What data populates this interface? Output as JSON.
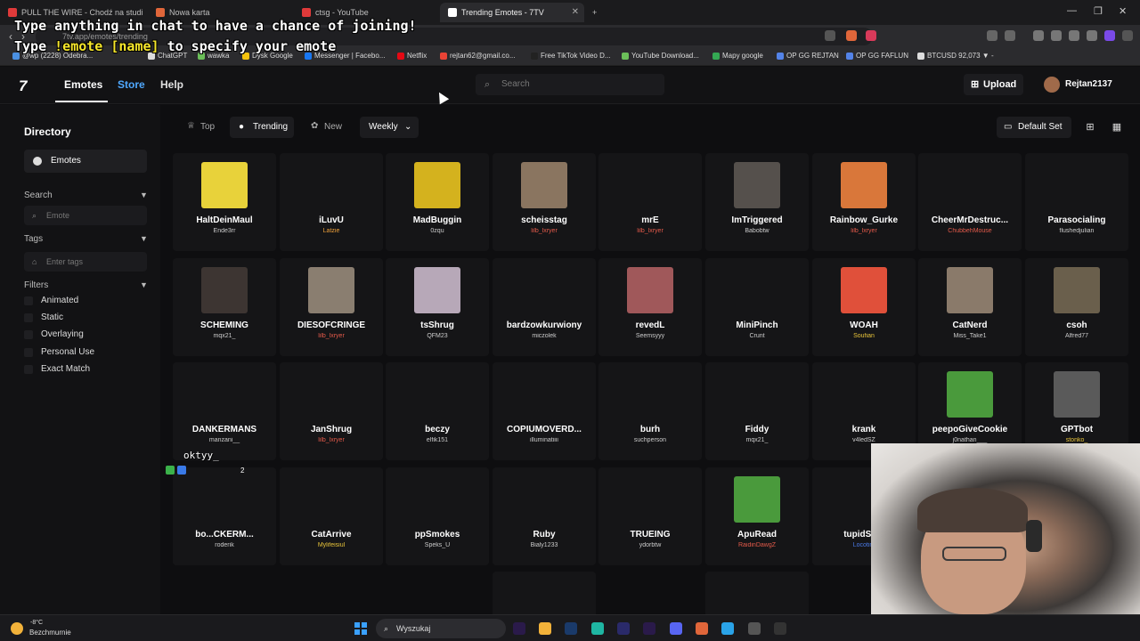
{
  "browser": {
    "tabs": [
      {
        "title": "PULL THE WIRE - Chodź na studia (Z",
        "favicon_color": "#e03a3a"
      },
      {
        "title": "Nowa karta",
        "favicon_color": "#e0663a"
      },
      {
        "title": "ctsg - YouTube",
        "favicon_color": "#e03a3a"
      },
      {
        "title": "Trending Emotes - 7TV",
        "favicon_color": "#ffffff"
      }
    ],
    "url": "7tv.app/emotes/trending",
    "bookmarks": [
      {
        "label": "@wp (2228) Odebra...",
        "color": "#4a90e2"
      },
      {
        "label": "ChatGPT",
        "color": "#dddddd"
      },
      {
        "label": "wawka",
        "color": "#6bbf59"
      },
      {
        "label": "Dysk Google",
        "color": "#f4c20d"
      },
      {
        "label": "Messenger | Facebo...",
        "color": "#1877f2"
      },
      {
        "label": "Netflix",
        "color": "#e50914"
      },
      {
        "label": "rejtan62@gmail.co...",
        "color": "#ea4335"
      },
      {
        "label": "Free TikTok Video D...",
        "color": "#222222"
      },
      {
        "label": "YouTube Download...",
        "color": "#6bbf59"
      },
      {
        "label": "Mapy google",
        "color": "#34a853"
      },
      {
        "label": "OP GG REJTAN",
        "color": "#5383e8"
      },
      {
        "label": "OP GG FAFLUN",
        "color": "#5383e8"
      },
      {
        "label": "BTCUSD 92,073 ▼ -",
        "color": "#dddddd"
      }
    ]
  },
  "overlay": {
    "line1": "Type anything in chat to have a chance of joining!",
    "line2_pre": "Type ",
    "line2_cmd": "!emote [name]",
    "line2_post": " to specify your emote"
  },
  "site": {
    "logo": "7",
    "nav": {
      "emotes": "Emotes",
      "store": "Store",
      "help": "Help"
    },
    "search_placeholder": "Search",
    "upload": "Upload",
    "username": "Rejtan2137"
  },
  "sidebar": {
    "directory": "Directory",
    "emotes": "Emotes",
    "search_label": "Search",
    "search_placeholder": "Emote",
    "tags_label": "Tags",
    "tags_placeholder": "Enter tags",
    "filters_label": "Filters",
    "filters": [
      "Animated",
      "Static",
      "Overlaying",
      "Personal Use",
      "Exact Match"
    ]
  },
  "toolbar": {
    "top": "Top",
    "trending": "Trending",
    "new": "New",
    "period": "Weekly",
    "default_set": "Default Set"
  },
  "emotes": [
    {
      "name": "HaltDeinMaul",
      "owner": "Ende3rr",
      "owner_color": "#cccccc",
      "thumb": "#e8d23a"
    },
    {
      "name": "iLuvU",
      "owner": "Latzie",
      "owner_color": "#f0a13a",
      "thumb": ""
    },
    {
      "name": "MadBuggin",
      "owner": "0zqu",
      "owner_color": "#cccccc",
      "thumb": "#d4b21e"
    },
    {
      "name": "scheisstag",
      "owner": "lilb_lxryer",
      "owner_color": "#e35a4a",
      "thumb": "#8a7560"
    },
    {
      "name": "mrE",
      "owner": "lilb_lxryer",
      "owner_color": "#e35a4a",
      "thumb": ""
    },
    {
      "name": "ImTriggered",
      "owner": "Babobtw",
      "owner_color": "#cccccc",
      "thumb": "#55504c"
    },
    {
      "name": "Rainbow_Gurke",
      "owner": "lilb_lxryer",
      "owner_color": "#e35a4a",
      "thumb": "#d9773a"
    },
    {
      "name": "CheerMrDestruc...",
      "owner": "ChubbehMouse",
      "owner_color": "#e35a4a",
      "thumb": ""
    },
    {
      "name": "Parasocialing",
      "owner": "flushedjulian",
      "owner_color": "#cccccc",
      "thumb": ""
    },
    {
      "name": "SCHEMING",
      "owner": "mqx21_",
      "owner_color": "#cccccc",
      "thumb": "#3d3532"
    },
    {
      "name": "DIESOFCRINGE",
      "owner": "lilb_lxryer",
      "owner_color": "#e35a4a",
      "thumb": "#8a7e70"
    },
    {
      "name": "tsShrug",
      "owner": "QFM23",
      "owner_color": "#cccccc",
      "thumb": "#b7a8b8"
    },
    {
      "name": "bardzowkurwiony",
      "owner": "miczolek",
      "owner_color": "#cccccc",
      "thumb": ""
    },
    {
      "name": "revedL",
      "owner": "Seemsyyy",
      "owner_color": "#cccccc",
      "thumb": "#a0585a"
    },
    {
      "name": "MiniPinch",
      "owner": "Crunt",
      "owner_color": "#cccccc",
      "thumb": ""
    },
    {
      "name": "WOAH",
      "owner": "Soufian",
      "owner_color": "#e8c43a",
      "thumb": "#e0503a"
    },
    {
      "name": "CatNerd",
      "owner": "Miss_Take1",
      "owner_color": "#cccccc",
      "thumb": "#8a7a6a"
    },
    {
      "name": "csoh",
      "owner": "Alfred77",
      "owner_color": "#cccccc",
      "thumb": "#6a5f4c"
    },
    {
      "name": "DANKERMANS",
      "owner": "manzani__",
      "owner_color": "#cccccc",
      "thumb": ""
    },
    {
      "name": "JanShrug",
      "owner": "lilb_lxryer",
      "owner_color": "#e35a4a",
      "thumb": ""
    },
    {
      "name": "beczy",
      "owner": "elfik151",
      "owner_color": "#cccccc",
      "thumb": ""
    },
    {
      "name": "COPIUMOVERD...",
      "owner": "illuminatiiii",
      "owner_color": "#cccccc",
      "thumb": ""
    },
    {
      "name": "burh",
      "owner": "suchperson",
      "owner_color": "#cccccc",
      "thumb": ""
    },
    {
      "name": "Fiddy",
      "owner": "mqx21_",
      "owner_color": "#cccccc",
      "thumb": ""
    },
    {
      "name": "krank",
      "owner": "v4ledSZ",
      "owner_color": "#cccccc",
      "thumb": ""
    },
    {
      "name": "peepoGiveCookie",
      "owner": "j0nathan___",
      "owner_color": "#cccccc",
      "thumb": "#4a9a3c"
    },
    {
      "name": "GPTbot",
      "owner": "stonko_",
      "owner_color": "#e8c43a",
      "thumb": "#5a5a5a"
    },
    {
      "name": "bo...CKERM...",
      "owner": "roderik",
      "owner_color": "#cccccc",
      "thumb": ""
    },
    {
      "name": "CatArrive",
      "owner": "Mylifeisiul",
      "owner_color": "#e8c43a",
      "thumb": ""
    },
    {
      "name": "ppSmokes",
      "owner": "Speks_U",
      "owner_color": "#cccccc",
      "thumb": ""
    },
    {
      "name": "Ruby",
      "owner": "Bialy1233",
      "owner_color": "#cccccc",
      "thumb": ""
    },
    {
      "name": "TRUEING",
      "owner": "ydorbtw",
      "owner_color": "#cccccc",
      "thumb": ""
    },
    {
      "name": "ApuRead",
      "owner": "RaidinDawgZ",
      "owner_color": "#e35a4a",
      "thumb": "#4a9a3c"
    },
    {
      "name": "tupidSq...",
      "owner": "Locotim",
      "owner_color": "#4a7ae8",
      "thumb": ""
    }
  ],
  "chat": {
    "text": "oktyy_",
    "count": "2"
  },
  "taskbar": {
    "temp": "-8°C",
    "weather": "Bezchmurnie",
    "search": "Wyszukaj"
  }
}
